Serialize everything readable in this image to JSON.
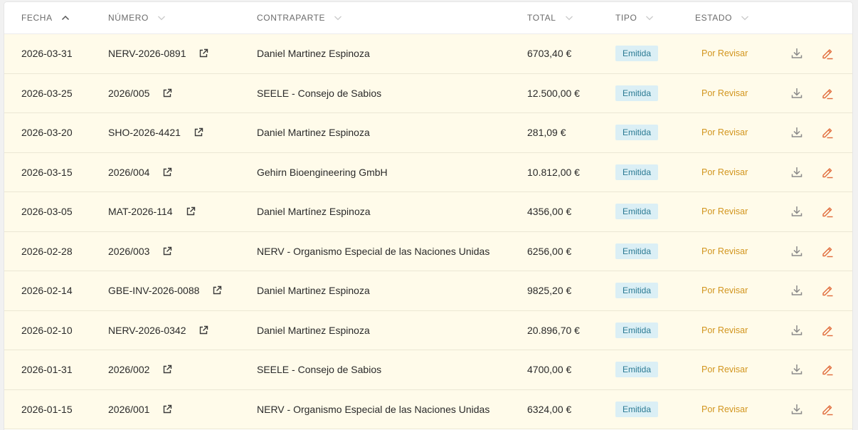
{
  "header": {
    "fecha": "FECHA",
    "numero": "NÚMERO",
    "contraparte": "CONTRAPARTE",
    "total": "TOTAL",
    "tipo": "TIPO",
    "estado": "ESTADO"
  },
  "colors": {
    "row_bg": "#fffbea",
    "badge_bg": "#dbeff5",
    "badge_text": "#2a7a93",
    "status_text": "#d2951e",
    "edit_icon": "#e06a3a",
    "download_icon": "#8a8a8a"
  },
  "icons": {
    "sort_active": "chevron-up-icon",
    "sort_inactive": "chevron-down-icon",
    "external": "external-link-icon",
    "download": "download-icon",
    "edit": "pencil-icon"
  },
  "rows": [
    {
      "fecha": "2026-03-31",
      "numero": "NERV-2026-0891",
      "contraparte": "Daniel Martinez Espinoza",
      "total": "6703,40 €",
      "tipo": "Emitida",
      "estado": "Por Revisar"
    },
    {
      "fecha": "2026-03-25",
      "numero": "2026/005",
      "contraparte": "SEELE - Consejo de Sabios",
      "total": "12.500,00 €",
      "tipo": "Emitida",
      "estado": "Por Revisar"
    },
    {
      "fecha": "2026-03-20",
      "numero": "SHO-2026-4421",
      "contraparte": "Daniel Martinez Espinoza",
      "total": "281,09 €",
      "tipo": "Emitida",
      "estado": "Por Revisar"
    },
    {
      "fecha": "2026-03-15",
      "numero": "2026/004",
      "contraparte": "Gehirn Bioengineering GmbH",
      "total": "10.812,00 €",
      "tipo": "Emitida",
      "estado": "Por Revisar"
    },
    {
      "fecha": "2026-03-05",
      "numero": "MAT-2026-114",
      "contraparte": "Daniel Martínez Espinoza",
      "total": "4356,00 €",
      "tipo": "Emitida",
      "estado": "Por Revisar"
    },
    {
      "fecha": "2026-02-28",
      "numero": "2026/003",
      "contraparte": "NERV - Organismo Especial de las Naciones Unidas",
      "total": "6256,00 €",
      "tipo": "Emitida",
      "estado": "Por Revisar"
    },
    {
      "fecha": "2026-02-14",
      "numero": "GBE-INV-2026-0088",
      "contraparte": "Daniel Martinez Espinoza",
      "total": "9825,20 €",
      "tipo": "Emitida",
      "estado": "Por Revisar"
    },
    {
      "fecha": "2026-02-10",
      "numero": "NERV-2026-0342",
      "contraparte": "Daniel Martinez Espinoza",
      "total": "20.896,70 €",
      "tipo": "Emitida",
      "estado": "Por Revisar"
    },
    {
      "fecha": "2026-01-31",
      "numero": "2026/002",
      "contraparte": "SEELE - Consejo de Sabios",
      "total": "4700,00 €",
      "tipo": "Emitida",
      "estado": "Por Revisar"
    },
    {
      "fecha": "2026-01-15",
      "numero": "2026/001",
      "contraparte": "NERV - Organismo Especial de las Naciones Unidas",
      "total": "6324,00 €",
      "tipo": "Emitida",
      "estado": "Por Revisar"
    }
  ]
}
